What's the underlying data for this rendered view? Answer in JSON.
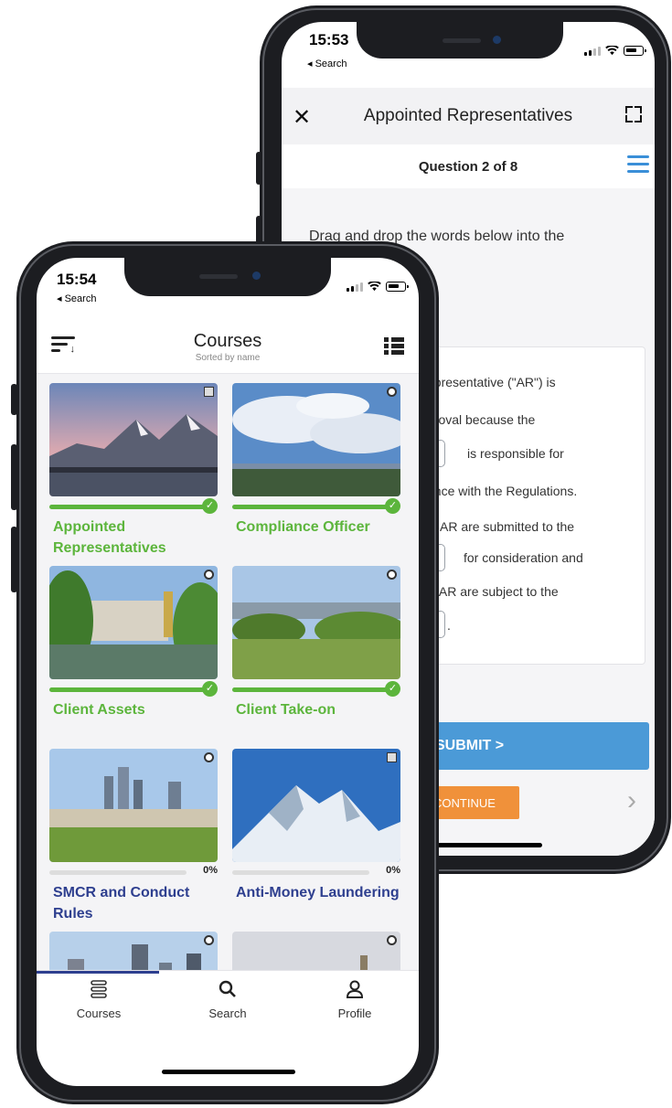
{
  "back_phone": {
    "status": {
      "time": "15:53",
      "back_label": "◂ Search"
    },
    "header": {
      "close_label": "✕",
      "title": "Appointed Representatives"
    },
    "question": {
      "label": "Question 2 of 8"
    },
    "instruction": "Drag and drop the words below into the correct position.",
    "passage_lines": [
      "epresentative (\"AR\") is",
      "proval because the",
      "is responsible for",
      "ance with the Regulations.",
      "AR are submitted to the",
      "for consideration and",
      "e AR are subject to the",
      "."
    ],
    "buttons": {
      "submit": "SUBMIT >",
      "continue": "CONTINUE",
      "next": "›"
    }
  },
  "front_phone": {
    "status": {
      "time": "15:54",
      "back_label": "◂ Search"
    },
    "header": {
      "title": "Courses",
      "subtitle": "Sorted by name"
    },
    "courses": [
      {
        "title": "Appointed Representatives",
        "progress": 1.0,
        "complete": true,
        "title_color": "#5cb53c",
        "icon": "check-icon",
        "badge": "camera-icon"
      },
      {
        "title": "Compliance Officer",
        "progress": 1.0,
        "complete": true,
        "title_color": "#5cb53c",
        "icon": "check-icon",
        "badge": "headphones-icon"
      },
      {
        "title": "Client Assets",
        "progress": 1.0,
        "complete": true,
        "title_color": "#5cb53c",
        "icon": "check-icon",
        "badge": "headphones-icon"
      },
      {
        "title": "Client Take-on",
        "progress": 1.0,
        "complete": true,
        "title_color": "#5cb53c",
        "icon": "check-icon",
        "badge": "headphones-icon"
      },
      {
        "title": "SMCR and Conduct Rules",
        "progress": 0.0,
        "percent_label": "0%",
        "complete": false,
        "title_color": "#2e3f8f",
        "badge": "headphones-icon"
      },
      {
        "title": "Anti-Money Laundering",
        "progress": 0.0,
        "percent_label": "0%",
        "complete": false,
        "title_color": "#2e3f8f",
        "badge": "camera-icon"
      },
      {
        "title": "",
        "progress": 0.0,
        "complete": false,
        "title_color": "#2e3f8f",
        "badge": "headphones-icon"
      },
      {
        "title": "",
        "progress": 0.0,
        "complete": false,
        "title_color": "#2e3f8f",
        "badge": "headphones-icon"
      }
    ],
    "tabs": [
      {
        "label": "Courses",
        "icon": "courses-icon",
        "active": true
      },
      {
        "label": "Search",
        "icon": "search-icon",
        "active": false
      },
      {
        "label": "Profile",
        "icon": "profile-icon",
        "active": false
      }
    ]
  },
  "colors": {
    "accent_blue": "#4b9ad7",
    "complete_green": "#5cb53c",
    "course_navy": "#2e3f8f",
    "continue_orange": "#f0913a"
  }
}
